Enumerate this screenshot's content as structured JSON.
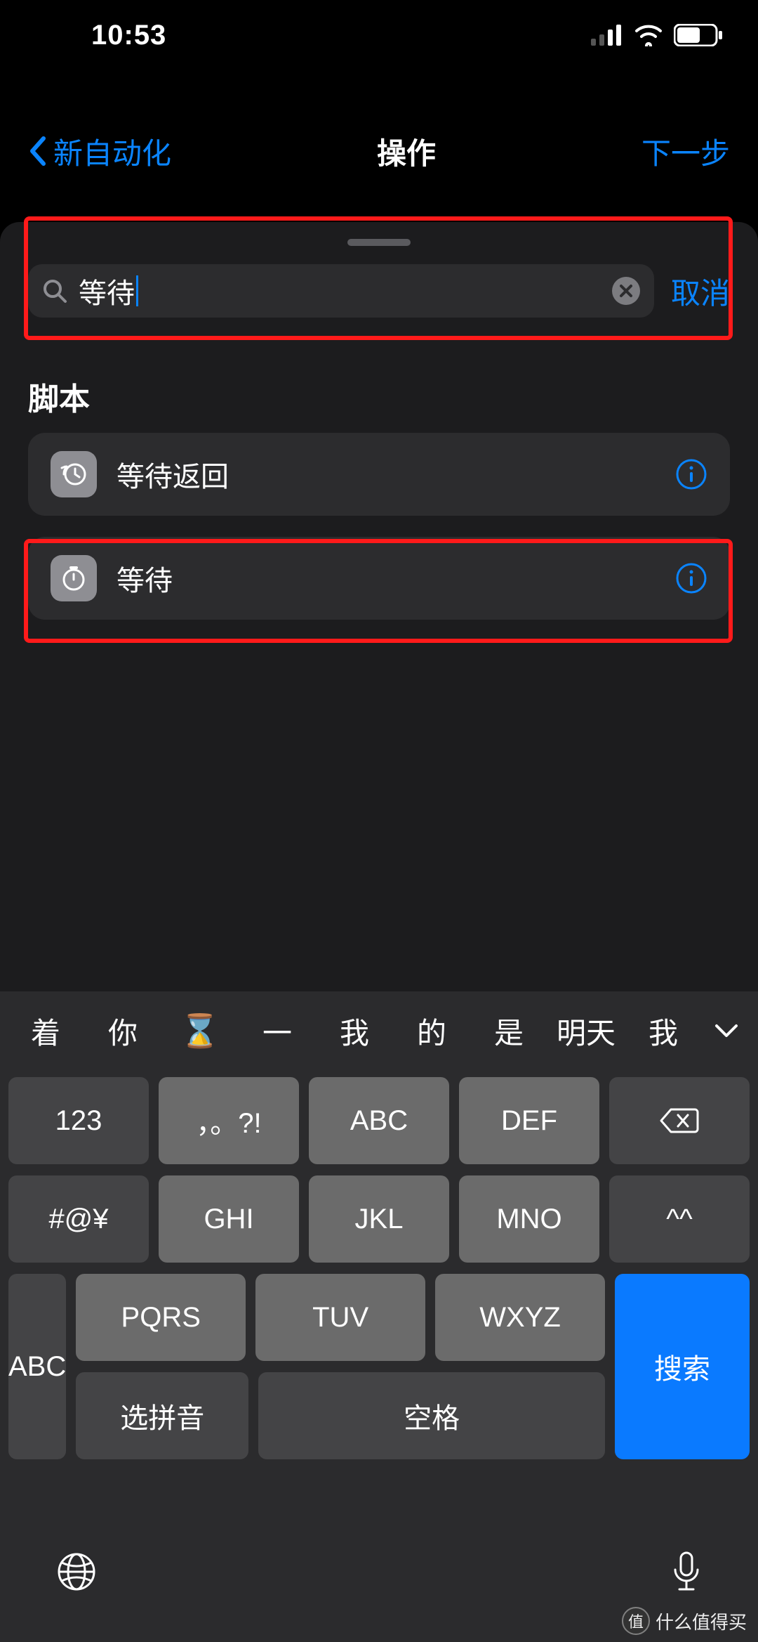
{
  "status": {
    "time": "10:53"
  },
  "nav": {
    "back": "新自动化",
    "title": "操作",
    "next": "下一步"
  },
  "search": {
    "query": "等待",
    "cancel": "取消"
  },
  "section": {
    "title": "脚本"
  },
  "results": [
    {
      "label": "等待返回",
      "icon": "history-icon"
    },
    {
      "label": "等待",
      "icon": "timer-icon"
    }
  ],
  "candidates": [
    "着",
    "你",
    "⌛",
    "一",
    "我",
    "的",
    "是",
    "明天",
    "我"
  ],
  "keyboard": {
    "row1": [
      "123",
      "，。?!",
      "ABC",
      "DEF"
    ],
    "row2": [
      "#@¥",
      "GHI",
      "JKL",
      "MNO",
      "^^"
    ],
    "row3": {
      "abc": "ABC",
      "pqrs": "PQRS",
      "tuv": "TUV",
      "wxyz": "WXYZ",
      "pinyin": "选拼音",
      "space": "空格",
      "search": "搜索"
    }
  },
  "watermark": {
    "badge": "值",
    "text": "什么值得买"
  }
}
